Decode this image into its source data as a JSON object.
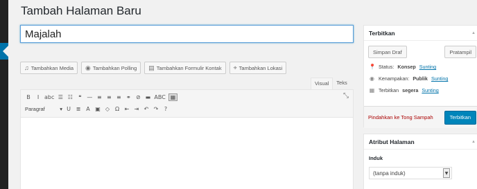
{
  "page": {
    "title": "Tambah Halaman Baru"
  },
  "post_title": {
    "value": "Majalah"
  },
  "media_buttons": [
    {
      "icon": "media-icon",
      "glyph": "♫",
      "label": "Tambahkan Media"
    },
    {
      "icon": "poll-icon",
      "glyph": "◉",
      "label": "Tambahkan Polling"
    },
    {
      "icon": "form-icon",
      "glyph": "▤",
      "label": "Tambahkan Formulir Kontak"
    },
    {
      "icon": "location-icon",
      "glyph": "⌖",
      "label": "Tambahkan Lokasi"
    }
  ],
  "editor": {
    "tabs": {
      "visual": "Visual",
      "text": "Teks"
    },
    "format_select": "Paragraf",
    "toolbar_row1": [
      {
        "name": "bold-icon",
        "glyph": "B"
      },
      {
        "name": "italic-icon",
        "glyph": "I"
      },
      {
        "name": "strikethrough-icon",
        "glyph": "abc"
      },
      {
        "name": "bullet-list-icon",
        "glyph": "☰"
      },
      {
        "name": "numbered-list-icon",
        "glyph": "☷"
      },
      {
        "name": "blockquote-icon",
        "glyph": "❝"
      },
      {
        "name": "horizontal-line-icon",
        "glyph": "—"
      },
      {
        "name": "align-left-icon",
        "glyph": "≡"
      },
      {
        "name": "align-center-icon",
        "glyph": "≡"
      },
      {
        "name": "align-right-icon",
        "glyph": "≡"
      },
      {
        "name": "link-icon",
        "glyph": "⚭"
      },
      {
        "name": "unlink-icon",
        "glyph": "⊘"
      },
      {
        "name": "read-more-icon",
        "glyph": "▬"
      },
      {
        "name": "spellcheck-icon",
        "glyph": "ABC"
      },
      {
        "name": "toolbar-toggle-icon",
        "glyph": "▦"
      }
    ],
    "toolbar_row2": [
      {
        "name": "underline-icon",
        "glyph": "U"
      },
      {
        "name": "justify-icon",
        "glyph": "≣"
      },
      {
        "name": "text-color-icon",
        "glyph": "A"
      },
      {
        "name": "paste-text-icon",
        "glyph": "▣"
      },
      {
        "name": "clear-format-icon",
        "glyph": "◇"
      },
      {
        "name": "special-char-icon",
        "glyph": "Ω"
      },
      {
        "name": "outdent-icon",
        "glyph": "⇤"
      },
      {
        "name": "indent-icon",
        "glyph": "⇥"
      },
      {
        "name": "undo-icon",
        "glyph": "↶"
      },
      {
        "name": "redo-icon",
        "glyph": "↷"
      },
      {
        "name": "help-icon",
        "glyph": "?"
      }
    ],
    "expand_glyph": "⤡"
  },
  "publish": {
    "title": "Terbitkan",
    "save_draft": "Simpan Draf",
    "preview": "Pratampil",
    "status_label": "Status:",
    "status_value": "Konsep",
    "visibility_label": "Kenampakan:",
    "visibility_value": "Publik",
    "schedule_label": "Terbitkan",
    "schedule_value": "segera",
    "edit_link": "Sunting",
    "trash": "Pindahkan ke Tong Sampah",
    "publish_btn": "Terbitkan"
  },
  "attributes": {
    "title": "Atribut Halaman",
    "parent_label": "Induk",
    "parent_value": "(tanpa induk)"
  }
}
